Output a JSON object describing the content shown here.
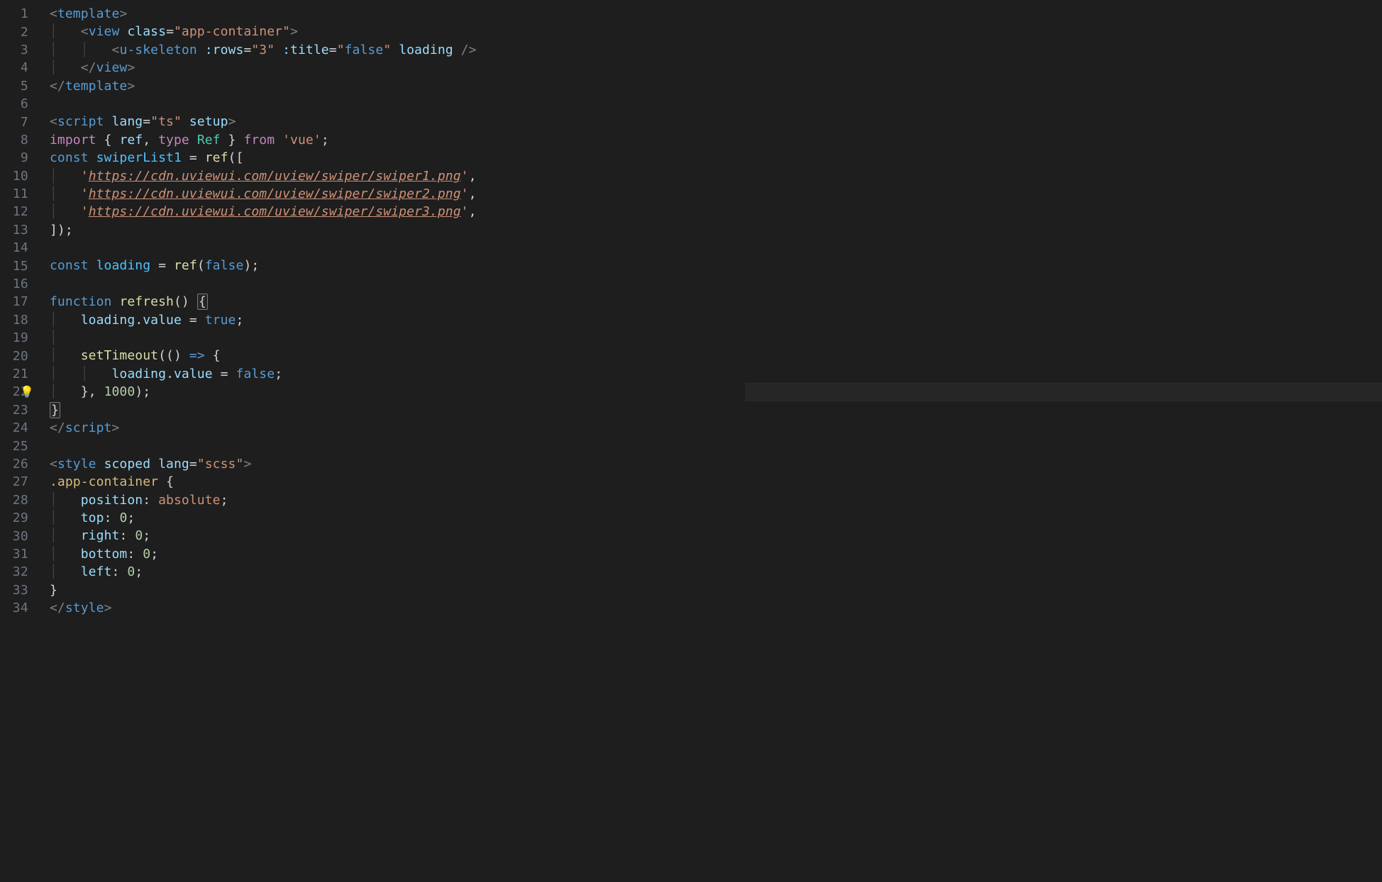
{
  "line_count": 34,
  "current_line": 22,
  "sections": {
    "template": {
      "start": 1,
      "end": 5
    },
    "script": {
      "start": 7,
      "end": 24
    },
    "style": {
      "start": 26,
      "end": 34
    }
  },
  "lines": {
    "1": {
      "tokens": [
        {
          "t": "<",
          "c": "punct"
        },
        {
          "t": "template",
          "c": "tag"
        },
        {
          "t": ">",
          "c": "punct"
        }
      ]
    },
    "2": {
      "indent": 1,
      "guides": 1,
      "tokens": [
        {
          "t": "<",
          "c": "punct"
        },
        {
          "t": "view",
          "c": "tag"
        },
        {
          "t": " ",
          "c": "op"
        },
        {
          "t": "class",
          "c": "attr"
        },
        {
          "t": "=",
          "c": "op"
        },
        {
          "t": "\"app-container\"",
          "c": "str"
        },
        {
          "t": ">",
          "c": "punct"
        }
      ]
    },
    "3": {
      "indent": 2,
      "guides": 2,
      "tokens": [
        {
          "t": "<",
          "c": "punct"
        },
        {
          "t": "u-skeleton",
          "c": "tag"
        },
        {
          "t": " ",
          "c": "op"
        },
        {
          "t": ":rows",
          "c": "attr"
        },
        {
          "t": "=",
          "c": "op"
        },
        {
          "t": "\"3\"",
          "c": "str"
        },
        {
          "t": " ",
          "c": "op"
        },
        {
          "t": ":title",
          "c": "attr"
        },
        {
          "t": "=",
          "c": "op"
        },
        {
          "t": "\"",
          "c": "str"
        },
        {
          "t": "false",
          "c": "bool"
        },
        {
          "t": "\"",
          "c": "str"
        },
        {
          "t": " ",
          "c": "op"
        },
        {
          "t": "loading",
          "c": "attr"
        },
        {
          "t": " />",
          "c": "punct"
        }
      ]
    },
    "4": {
      "indent": 1,
      "guides": 1,
      "tokens": [
        {
          "t": "</",
          "c": "punct"
        },
        {
          "t": "view",
          "c": "tag"
        },
        {
          "t": ">",
          "c": "punct"
        }
      ]
    },
    "5": {
      "tokens": [
        {
          "t": "</",
          "c": "punct"
        },
        {
          "t": "template",
          "c": "tag"
        },
        {
          "t": ">",
          "c": "punct"
        }
      ]
    },
    "6": {
      "tokens": []
    },
    "7": {
      "tokens": [
        {
          "t": "<",
          "c": "punct"
        },
        {
          "t": "script",
          "c": "tag"
        },
        {
          "t": " ",
          "c": "op"
        },
        {
          "t": "lang",
          "c": "attr"
        },
        {
          "t": "=",
          "c": "op"
        },
        {
          "t": "\"ts\"",
          "c": "str"
        },
        {
          "t": " ",
          "c": "op"
        },
        {
          "t": "setup",
          "c": "attr"
        },
        {
          "t": ">",
          "c": "punct"
        }
      ]
    },
    "8": {
      "tokens": [
        {
          "t": "import",
          "c": "kw"
        },
        {
          "t": " { ",
          "c": "op"
        },
        {
          "t": "ref",
          "c": "var"
        },
        {
          "t": ", ",
          "c": "op"
        },
        {
          "t": "type",
          "c": "kw"
        },
        {
          "t": " ",
          "c": "op"
        },
        {
          "t": "Ref",
          "c": "type"
        },
        {
          "t": " } ",
          "c": "op"
        },
        {
          "t": "from",
          "c": "kw"
        },
        {
          "t": " ",
          "c": "op"
        },
        {
          "t": "'vue'",
          "c": "str"
        },
        {
          "t": ";",
          "c": "op"
        }
      ]
    },
    "9": {
      "tokens": [
        {
          "t": "const",
          "c": "kw2"
        },
        {
          "t": " ",
          "c": "op"
        },
        {
          "t": "swiperList1",
          "c": "const"
        },
        {
          "t": " = ",
          "c": "op"
        },
        {
          "t": "ref",
          "c": "func"
        },
        {
          "t": "([",
          "c": "op"
        }
      ]
    },
    "10": {
      "indent": 1,
      "guides": 1,
      "tokens": [
        {
          "t": "'",
          "c": "str"
        },
        {
          "t": "https://cdn.uviewui.com/uview/swiper/swiper1.png",
          "c": "url"
        },
        {
          "t": "'",
          "c": "str"
        },
        {
          "t": ",",
          "c": "op"
        }
      ]
    },
    "11": {
      "indent": 1,
      "guides": 1,
      "tokens": [
        {
          "t": "'",
          "c": "str"
        },
        {
          "t": "https://cdn.uviewui.com/uview/swiper/swiper2.png",
          "c": "url"
        },
        {
          "t": "'",
          "c": "str"
        },
        {
          "t": ",",
          "c": "op"
        }
      ]
    },
    "12": {
      "indent": 1,
      "guides": 1,
      "tokens": [
        {
          "t": "'",
          "c": "str"
        },
        {
          "t": "https://cdn.uviewui.com/uview/swiper/swiper3.png",
          "c": "url"
        },
        {
          "t": "'",
          "c": "str"
        },
        {
          "t": ",",
          "c": "op"
        }
      ]
    },
    "13": {
      "tokens": [
        {
          "t": "]);",
          "c": "op"
        }
      ]
    },
    "14": {
      "tokens": []
    },
    "15": {
      "tokens": [
        {
          "t": "const",
          "c": "kw2"
        },
        {
          "t": " ",
          "c": "op"
        },
        {
          "t": "loading",
          "c": "const"
        },
        {
          "t": " = ",
          "c": "op"
        },
        {
          "t": "ref",
          "c": "func"
        },
        {
          "t": "(",
          "c": "op"
        },
        {
          "t": "false",
          "c": "bool"
        },
        {
          "t": ");",
          "c": "op"
        }
      ]
    },
    "16": {
      "tokens": []
    },
    "17": {
      "tokens": [
        {
          "t": "function",
          "c": "kw2"
        },
        {
          "t": " ",
          "c": "op"
        },
        {
          "t": "refresh",
          "c": "func"
        },
        {
          "t": "() ",
          "c": "op"
        },
        {
          "t": "{",
          "c": "brace-hl"
        }
      ]
    },
    "18": {
      "indent": 1,
      "guides": 1,
      "tokens": [
        {
          "t": "loading",
          "c": "var"
        },
        {
          "t": ".",
          "c": "op"
        },
        {
          "t": "value",
          "c": "prop"
        },
        {
          "t": " = ",
          "c": "op"
        },
        {
          "t": "true",
          "c": "bool"
        },
        {
          "t": ";",
          "c": "op"
        }
      ]
    },
    "19": {
      "guides": 1,
      "tokens": []
    },
    "20": {
      "indent": 1,
      "guides": 1,
      "tokens": [
        {
          "t": "setTimeout",
          "c": "func"
        },
        {
          "t": "((",
          "c": "op"
        },
        {
          "t": ") ",
          "c": "op"
        },
        {
          "t": "=>",
          "c": "kw2"
        },
        {
          "t": " {",
          "c": "op"
        }
      ]
    },
    "21": {
      "indent": 2,
      "guides": 2,
      "tokens": [
        {
          "t": "loading",
          "c": "var"
        },
        {
          "t": ".",
          "c": "op"
        },
        {
          "t": "value",
          "c": "prop"
        },
        {
          "t": " = ",
          "c": "op"
        },
        {
          "t": "false",
          "c": "bool"
        },
        {
          "t": ";",
          "c": "op"
        }
      ]
    },
    "22": {
      "indent": 1,
      "guides": 1,
      "bulb": true,
      "tokens": [
        {
          "t": "}, ",
          "c": "op"
        },
        {
          "t": "1000",
          "c": "num"
        },
        {
          "t": ");",
          "c": "op"
        }
      ]
    },
    "23": {
      "tokens": [
        {
          "t": "}",
          "c": "brace-hl"
        }
      ]
    },
    "24": {
      "tokens": [
        {
          "t": "</",
          "c": "punct"
        },
        {
          "t": "script",
          "c": "tag"
        },
        {
          "t": ">",
          "c": "punct"
        }
      ]
    },
    "25": {
      "tokens": []
    },
    "26": {
      "tokens": [
        {
          "t": "<",
          "c": "punct"
        },
        {
          "t": "style",
          "c": "tag"
        },
        {
          "t": " ",
          "c": "op"
        },
        {
          "t": "scoped",
          "c": "attr"
        },
        {
          "t": " ",
          "c": "op"
        },
        {
          "t": "lang",
          "c": "attr"
        },
        {
          "t": "=",
          "c": "op"
        },
        {
          "t": "\"scss\"",
          "c": "str"
        },
        {
          "t": ">",
          "c": "punct"
        }
      ]
    },
    "27": {
      "tokens": [
        {
          "t": ".app-container",
          "c": "sel"
        },
        {
          "t": " {",
          "c": "op"
        }
      ]
    },
    "28": {
      "indent": 1,
      "guides": 1,
      "tokens": [
        {
          "t": "position",
          "c": "cssprop"
        },
        {
          "t": ": ",
          "c": "op"
        },
        {
          "t": "absolute",
          "c": "str"
        },
        {
          "t": ";",
          "c": "op"
        }
      ]
    },
    "29": {
      "indent": 1,
      "guides": 1,
      "tokens": [
        {
          "t": "top",
          "c": "cssprop"
        },
        {
          "t": ": ",
          "c": "op"
        },
        {
          "t": "0",
          "c": "num"
        },
        {
          "t": ";",
          "c": "op"
        }
      ]
    },
    "30": {
      "indent": 1,
      "guides": 1,
      "tokens": [
        {
          "t": "right",
          "c": "cssprop"
        },
        {
          "t": ": ",
          "c": "op"
        },
        {
          "t": "0",
          "c": "num"
        },
        {
          "t": ";",
          "c": "op"
        }
      ]
    },
    "31": {
      "indent": 1,
      "guides": 1,
      "tokens": [
        {
          "t": "bottom",
          "c": "cssprop"
        },
        {
          "t": ": ",
          "c": "op"
        },
        {
          "t": "0",
          "c": "num"
        },
        {
          "t": ";",
          "c": "op"
        }
      ]
    },
    "32": {
      "indent": 1,
      "guides": 1,
      "tokens": [
        {
          "t": "left",
          "c": "cssprop"
        },
        {
          "t": ": ",
          "c": "op"
        },
        {
          "t": "0",
          "c": "num"
        },
        {
          "t": ";",
          "c": "op"
        }
      ]
    },
    "33": {
      "tokens": [
        {
          "t": "}",
          "c": "op"
        }
      ]
    },
    "34": {
      "tokens": [
        {
          "t": "</",
          "c": "punct"
        },
        {
          "t": "style",
          "c": "tag"
        },
        {
          "t": ">",
          "c": "punct"
        }
      ]
    }
  }
}
